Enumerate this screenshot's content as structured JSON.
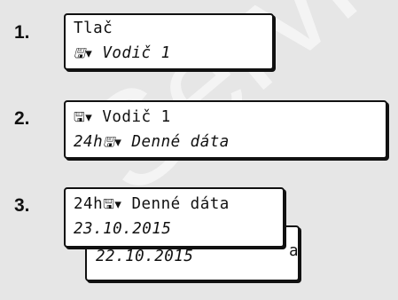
{
  "watermark": "Service only",
  "steps": [
    {
      "number": "1.",
      "line1": "Tlač",
      "line2_icon": "🖫▾",
      "line2_text": "Vodič 1"
    },
    {
      "number": "2.",
      "line1_icon": "🖫▾",
      "line1_text": "Vodič 1",
      "line2_prefix": "24h",
      "line2_icon": "🖫▾",
      "line2_text": "Denné dáta"
    },
    {
      "number": "3.",
      "line1_prefix": "24h",
      "line1_icon": "🖫▾",
      "line1_text": "Denné dáta",
      "line2": "23.10.2015",
      "back_line": "22.10.2015",
      "back_right_char": "a"
    }
  ],
  "icons": {
    "card": "card-driver-icon"
  }
}
